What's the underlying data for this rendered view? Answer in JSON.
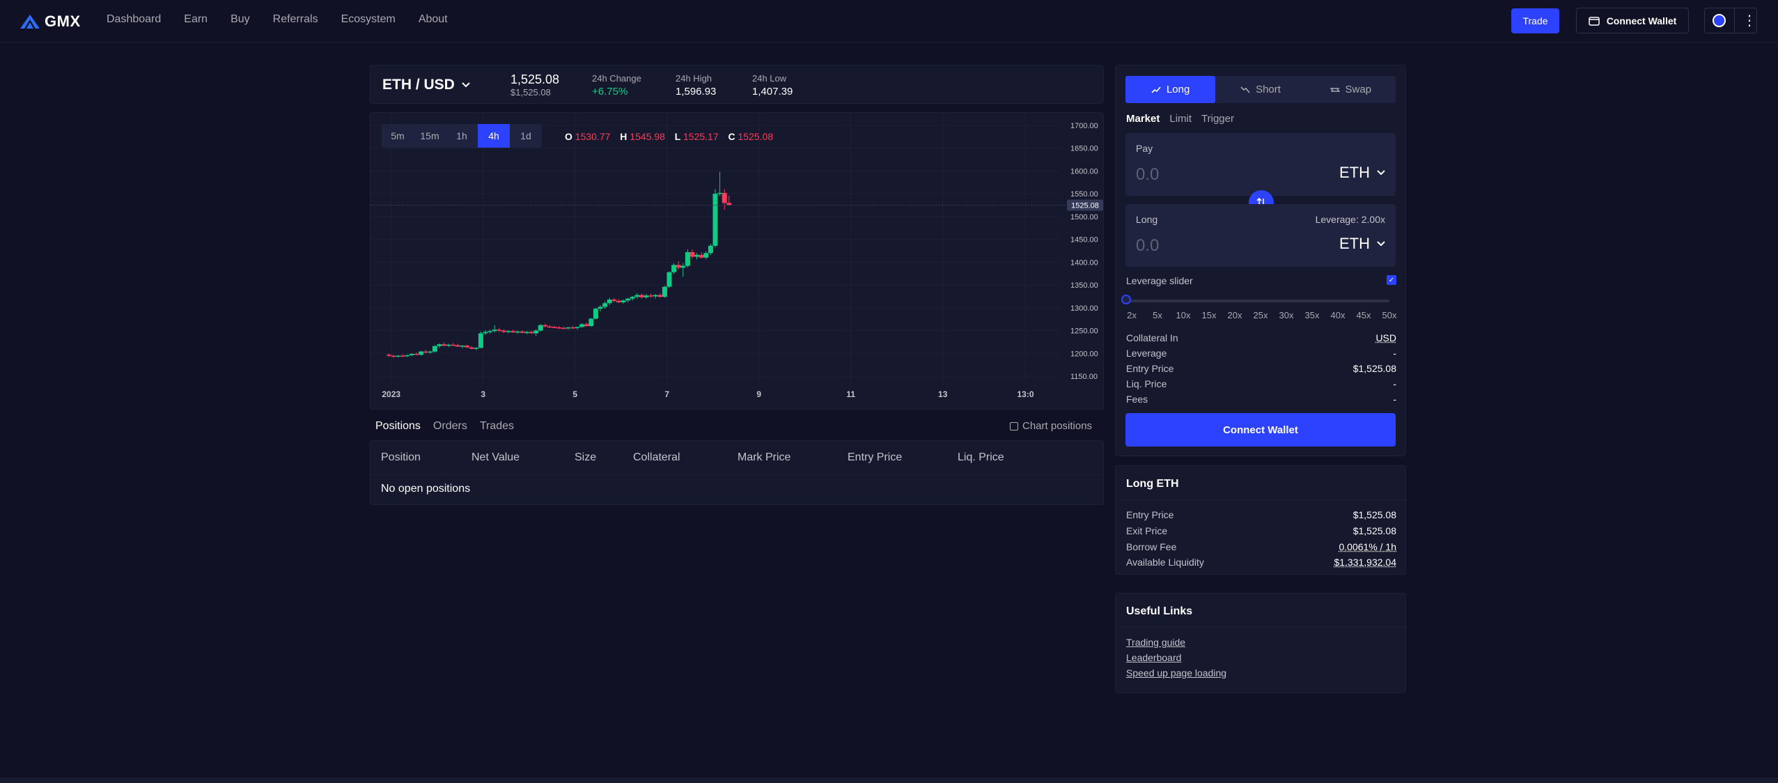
{
  "header": {
    "logo_text": "GMX",
    "nav": [
      "Dashboard",
      "Earn",
      "Buy",
      "Referrals",
      "Ecosystem",
      "About"
    ],
    "trade_label": "Trade",
    "connect_wallet_label": "Connect Wallet"
  },
  "price_bar": {
    "pair": "ETH / USD",
    "price": "1,525.08",
    "price_usd": "$1,525.08",
    "change_label": "24h Change",
    "change_value": "+6.75%",
    "high_label": "24h High",
    "high_value": "1,596.93",
    "low_label": "24h Low",
    "low_value": "1,407.39"
  },
  "chart": {
    "timeframes": [
      "5m",
      "15m",
      "1h",
      "4h",
      "1d"
    ],
    "active_timeframe": "4h",
    "ohlc": {
      "o_label": "O",
      "o": "1530.77",
      "h_label": "H",
      "h": "1545.98",
      "l_label": "L",
      "l": "1525.17",
      "c_label": "C",
      "c": "1525.08"
    },
    "current_price_tag": "1525.08",
    "colors": {
      "up": "#0ecc83",
      "down": "#fa3c58"
    }
  },
  "chart_data": {
    "type": "candlestick",
    "y_ticks": [
      1700,
      1650,
      1600,
      1550,
      1500,
      1450,
      1400,
      1350,
      1300,
      1250,
      1200,
      1150
    ],
    "y_tick_labels": [
      "1700.00",
      "1650.00",
      "1600.00",
      "1550.00",
      "1500.00",
      "1450.00",
      "1400.00",
      "1350.00",
      "1300.00",
      "1250.00",
      "1200.00",
      "1150.00"
    ],
    "ylim": [
      1130,
      1710
    ],
    "x_tick_labels": [
      "2023",
      "3",
      "5",
      "7",
      "9",
      "11",
      "13",
      "13:0"
    ],
    "x_ticks": [
      0.5,
      20.5,
      40.5,
      60.5,
      80.5,
      100.5,
      120.5,
      138.5
    ],
    "xlim": [
      -4,
      146
    ],
    "candles": [
      [
        1197,
        1200,
        1192,
        1195
      ],
      [
        1195,
        1197,
        1190,
        1193
      ],
      [
        1193,
        1196,
        1191,
        1195
      ],
      [
        1195,
        1198,
        1192,
        1194
      ],
      [
        1194,
        1197,
        1192,
        1196
      ],
      [
        1196,
        1200,
        1194,
        1199
      ],
      [
        1199,
        1202,
        1196,
        1197
      ],
      [
        1197,
        1206,
        1195,
        1204
      ],
      [
        1204,
        1208,
        1200,
        1202
      ],
      [
        1202,
        1206,
        1199,
        1204
      ],
      [
        1204,
        1218,
        1202,
        1216
      ],
      [
        1216,
        1222,
        1212,
        1220
      ],
      [
        1220,
        1224,
        1215,
        1217
      ],
      [
        1217,
        1221,
        1214,
        1219
      ],
      [
        1219,
        1223,
        1216,
        1218
      ],
      [
        1218,
        1221,
        1214,
        1215
      ],
      [
        1215,
        1218,
        1211,
        1217
      ],
      [
        1217,
        1219,
        1212,
        1213
      ],
      [
        1213,
        1216,
        1209,
        1210
      ],
      [
        1210,
        1214,
        1207,
        1212
      ],
      [
        1212,
        1248,
        1211,
        1244
      ],
      [
        1244,
        1251,
        1240,
        1247
      ],
      [
        1247,
        1252,
        1243,
        1249
      ],
      [
        1249,
        1262,
        1246,
        1252
      ],
      [
        1252,
        1256,
        1247,
        1250
      ],
      [
        1250,
        1253,
        1245,
        1247
      ],
      [
        1247,
        1251,
        1244,
        1249
      ],
      [
        1249,
        1252,
        1245,
        1246
      ],
      [
        1246,
        1250,
        1243,
        1248
      ],
      [
        1248,
        1251,
        1244,
        1245
      ],
      [
        1245,
        1249,
        1242,
        1247
      ],
      [
        1247,
        1250,
        1243,
        1244
      ],
      [
        1244,
        1253,
        1238,
        1250
      ],
      [
        1250,
        1264,
        1248,
        1262
      ],
      [
        1262,
        1265,
        1257,
        1259
      ],
      [
        1259,
        1262,
        1256,
        1258
      ],
      [
        1258,
        1261,
        1255,
        1257
      ],
      [
        1257,
        1260,
        1254,
        1256
      ],
      [
        1256,
        1259,
        1253,
        1255
      ],
      [
        1255,
        1258,
        1252,
        1257
      ],
      [
        1257,
        1260,
        1254,
        1256
      ],
      [
        1256,
        1259,
        1252,
        1258
      ],
      [
        1258,
        1266,
        1256,
        1264
      ],
      [
        1264,
        1268,
        1258,
        1260
      ],
      [
        1260,
        1278,
        1258,
        1276
      ],
      [
        1276,
        1300,
        1274,
        1298
      ],
      [
        1298,
        1306,
        1292,
        1302
      ],
      [
        1302,
        1314,
        1298,
        1310
      ],
      [
        1310,
        1322,
        1306,
        1318
      ],
      [
        1318,
        1322,
        1312,
        1315
      ],
      [
        1315,
        1319,
        1310,
        1312
      ],
      [
        1312,
        1318,
        1309,
        1316
      ],
      [
        1316,
        1322,
        1312,
        1320
      ],
      [
        1320,
        1326,
        1316,
        1324
      ],
      [
        1324,
        1332,
        1320,
        1328
      ],
      [
        1328,
        1331,
        1320,
        1323
      ],
      [
        1323,
        1330,
        1320,
        1327
      ],
      [
        1327,
        1331,
        1322,
        1325
      ],
      [
        1325,
        1330,
        1320,
        1328
      ],
      [
        1328,
        1332,
        1322,
        1324
      ],
      [
        1324,
        1348,
        1322,
        1346
      ],
      [
        1346,
        1380,
        1344,
        1378
      ],
      [
        1378,
        1398,
        1374,
        1394
      ],
      [
        1394,
        1402,
        1384,
        1388
      ],
      [
        1388,
        1398,
        1368,
        1392
      ],
      [
        1392,
        1428,
        1388,
        1422
      ],
      [
        1422,
        1428,
        1408,
        1412
      ],
      [
        1412,
        1420,
        1406,
        1416
      ],
      [
        1416,
        1422,
        1408,
        1410
      ],
      [
        1410,
        1424,
        1406,
        1420
      ],
      [
        1420,
        1440,
        1416,
        1436
      ],
      [
        1436,
        1560,
        1432,
        1550
      ],
      [
        1550,
        1598,
        1545,
        1552
      ],
      [
        1552,
        1560,
        1515,
        1530
      ],
      [
        1530,
        1546,
        1525,
        1525
      ]
    ]
  },
  "positions": {
    "tabs": [
      "Positions",
      "Orders",
      "Trades"
    ],
    "chart_positions_label": "Chart positions",
    "columns": [
      "Position",
      "Net Value",
      "Size",
      "Collateral",
      "Mark Price",
      "Entry Price",
      "Liq. Price"
    ],
    "empty_text": "No open positions"
  },
  "swap_box": {
    "modes": [
      "Long",
      "Short",
      "Swap"
    ],
    "order_types": [
      "Market",
      "Limit",
      "Trigger"
    ],
    "pay_label": "Pay",
    "pay_value": "0.0",
    "pay_token": "ETH",
    "long_label": "Long",
    "leverage_label": "Leverage: 2.00x",
    "long_value": "0.0",
    "long_token": "ETH",
    "leverage_slider_label": "Leverage slider",
    "slider_marks": [
      "2x",
      "5x",
      "10x",
      "15x",
      "20x",
      "25x",
      "30x",
      "35x",
      "40x",
      "45x",
      "50x"
    ],
    "slider_level": 2,
    "info": [
      {
        "label": "Collateral In",
        "value": "USD"
      },
      {
        "label": "Leverage",
        "value": "-"
      },
      {
        "label": "Entry Price",
        "value": "$1,525.08"
      },
      {
        "label": "Liq. Price",
        "value": "-"
      },
      {
        "label": "Fees",
        "value": "-"
      }
    ],
    "connect_label": "Connect Wallet"
  },
  "long_eth": {
    "title": "Long ETH",
    "rows": [
      {
        "label": "Entry Price",
        "value": "$1,525.08"
      },
      {
        "label": "Exit Price",
        "value": "$1,525.08"
      },
      {
        "label": "Borrow Fee",
        "value": "0.0061% / 1h"
      },
      {
        "label": "Available Liquidity",
        "value": "$1,331,932.04"
      }
    ]
  },
  "useful_links": {
    "title": "Useful Links",
    "links": [
      "Trading guide",
      "Leaderboard",
      "Speed up page loading"
    ]
  }
}
